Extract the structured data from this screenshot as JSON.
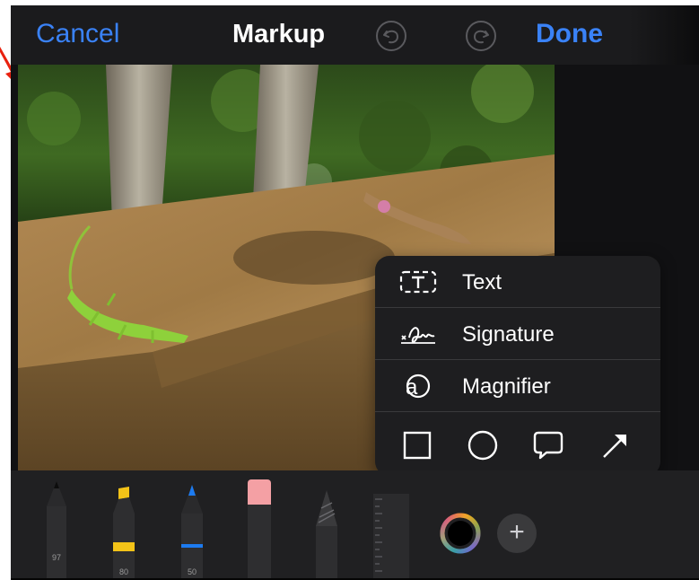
{
  "navbar": {
    "cancel_label": "Cancel",
    "title": "Markup",
    "done_label": "Done",
    "undo_icon": "undo-icon",
    "redo_icon": "redo-icon"
  },
  "menu": {
    "items": [
      {
        "label": "Text",
        "icon": "text-box-icon"
      },
      {
        "label": "Signature",
        "icon": "signature-icon"
      },
      {
        "label": "Magnifier",
        "icon": "magnifier-icon"
      }
    ],
    "shapes": [
      "square-icon",
      "circle-icon",
      "speech-bubble-icon",
      "arrow-icon"
    ]
  },
  "toolbar": {
    "tools": [
      {
        "name": "pen",
        "width_label": "97"
      },
      {
        "name": "highlighter",
        "width_label": "80",
        "color": "#f3c318"
      },
      {
        "name": "pencil",
        "width_label": "50",
        "color": "#1d7bf0"
      },
      {
        "name": "eraser"
      },
      {
        "name": "lasso"
      },
      {
        "name": "ruler"
      }
    ],
    "color_picker_icon": "color-wheel-icon",
    "add_icon": "plus-icon",
    "add_label": "+"
  },
  "colors": {
    "accent": "#3a82f7",
    "background": "#111113",
    "popover": "#1e1e20"
  }
}
